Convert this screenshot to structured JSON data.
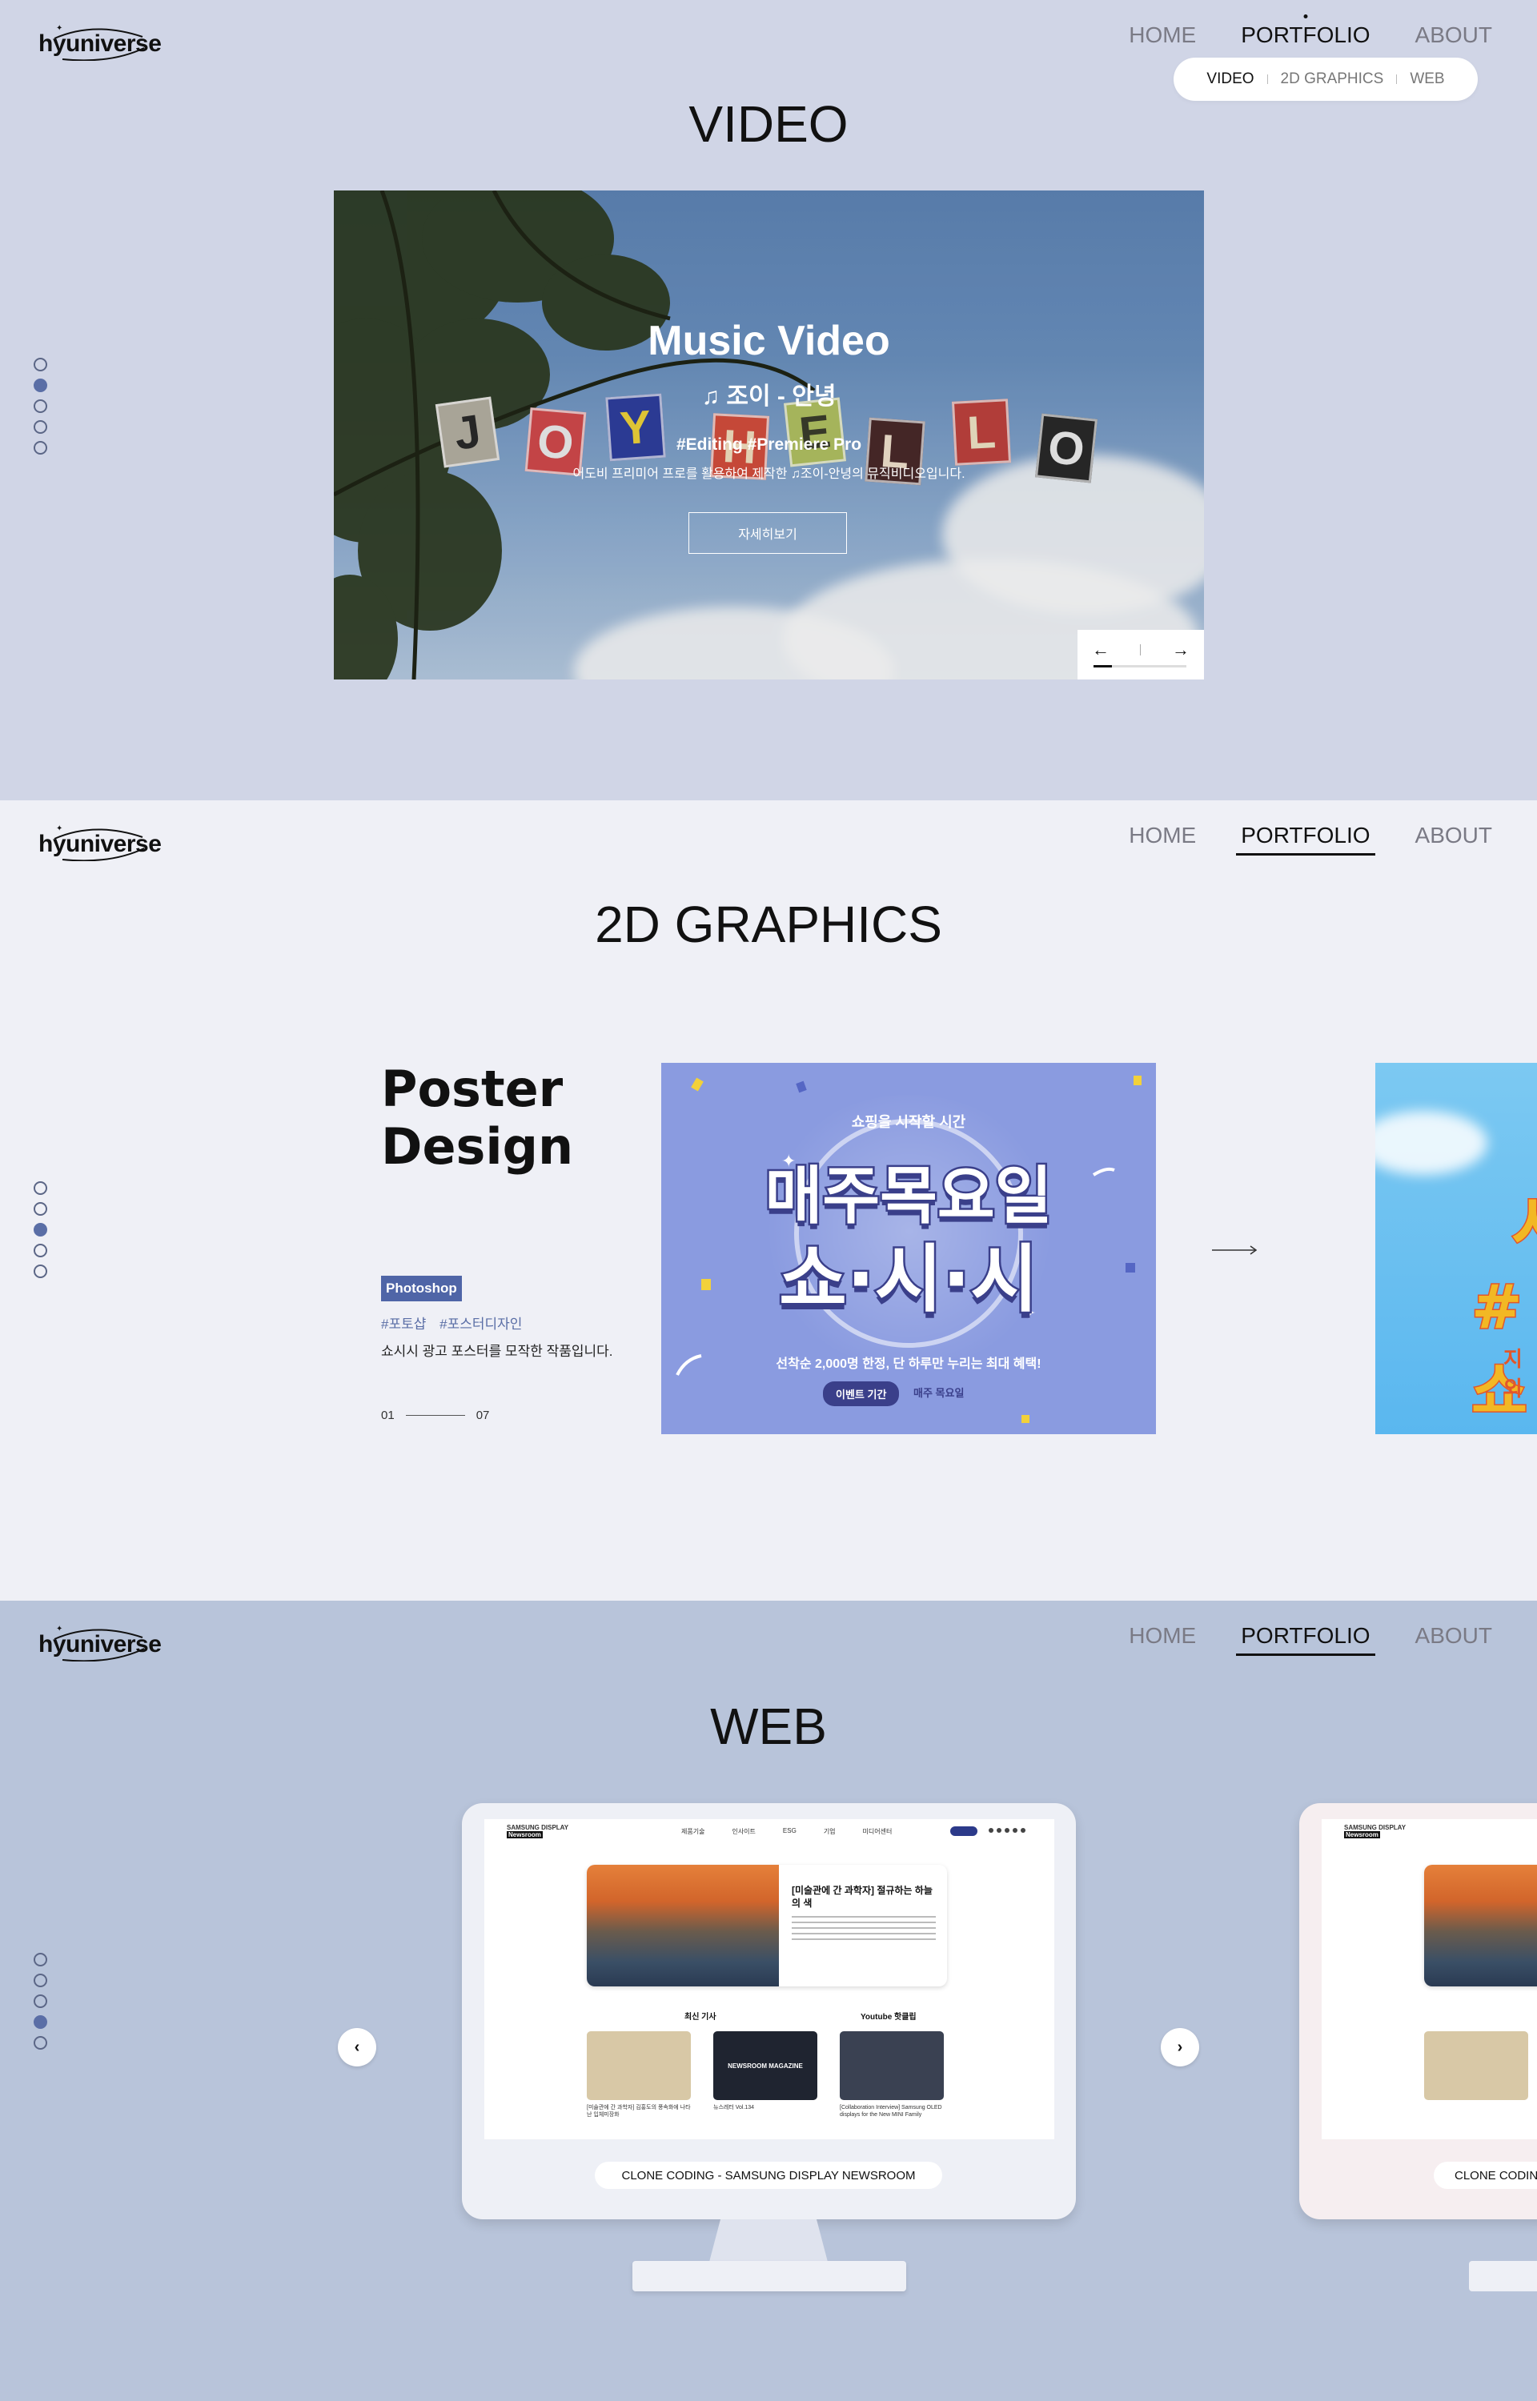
{
  "brand": {
    "logo_text": "hyuniverse"
  },
  "nav": {
    "home": "HOME",
    "portfolio": "PORTFOLIO",
    "about": "ABOUT"
  },
  "subnav": {
    "video": "VIDEO",
    "graphics": "2D GRAPHICS",
    "web": "WEB"
  },
  "video": {
    "title": "VIDEO",
    "slide_title": "Music Video",
    "song": "♫ 조이 - 안녕",
    "tags": "#Editing  #Premiere Pro",
    "description": "어도비 프리미어 프로를 활용하여 제작한 ♫조이-안녕의 뮤직비디오입니다.",
    "button": "자세히보기",
    "prev": "←",
    "next": "→",
    "progress": 0.2,
    "letters": [
      "J",
      "O",
      "Y",
      "H",
      "E",
      "L",
      "L",
      "O"
    ],
    "pager_active": 1
  },
  "graphics": {
    "title": "2D GRAPHICS",
    "project_title_1": "Poster",
    "project_title_2": "Design",
    "tool": "Photoshop",
    "tags": [
      "#포토샵",
      "#포스터디자인"
    ],
    "description": "쇼시시 광고 포스터를 모작한 작품입니다.",
    "counter_current": "01",
    "counter_total": "07",
    "poster": {
      "kicker": "쇼핑을 시작할 시간",
      "line1": "매주목요일",
      "line2": "쇼·시·시",
      "bottom": "선착순 2,000명 한정, 단 하루만 누리는 최대 혜택!",
      "pill": "이벤트 기간",
      "pill_side": "매주 목요일"
    },
    "next_poster": {
      "line1": "시",
      "line2": "#쇼",
      "line3": "지외"
    },
    "pager_active": 2
  },
  "web": {
    "title": "WEB",
    "caption": "CLONE CODING - SAMSUNG DISPLAY NEWSROOM",
    "caption_next": "CLONE CODING",
    "prev": "‹",
    "next": "›",
    "screenshot": {
      "brand_1": "SAMSUNG DISPLAY",
      "brand_2": "Newsroom",
      "menu": [
        "제품기술",
        "인사이트",
        "ESG",
        "기업",
        "미디어센터"
      ],
      "card_title": "[미술관에 간 과학자] 절규하는 하늘의 색",
      "col1": "최신 기사",
      "col2": "Youtube 핫클립",
      "thumb_caps": [
        "[미술관에 간 과학자] 김홍도의 풍속화에 나타난 입체미장화",
        "뉴스레터 Vol.134",
        "[Collaboration Interview] Samsung OLED displays for the New MINI Family"
      ],
      "thumb_mag": "NEWSROOM MAGAZINE"
    },
    "pager_active": 3
  },
  "colors": {
    "accent": "#5a6ea6",
    "video_bg": "#d0d5e6",
    "graphics_bg": "#eff0f6",
    "web_bg": "#b8c4da"
  }
}
